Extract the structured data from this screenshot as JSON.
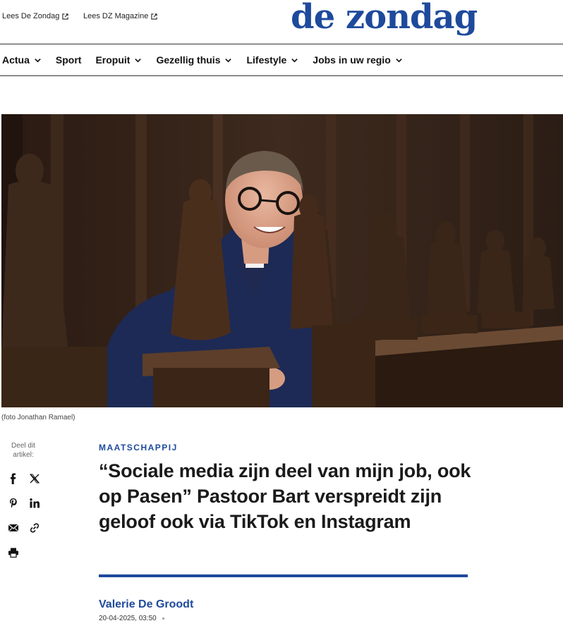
{
  "header": {
    "links": [
      {
        "label": "Lees De Zondag",
        "icon": "external-link-icon"
      },
      {
        "label": "Lees DZ Magazine",
        "icon": "external-link-icon"
      }
    ],
    "logo": "de zondag"
  },
  "nav": {
    "items": [
      {
        "label": "Actua",
        "has_dropdown": true
      },
      {
        "label": "Sport",
        "has_dropdown": false
      },
      {
        "label": "Eropuit",
        "has_dropdown": true
      },
      {
        "label": "Gezellig thuis",
        "has_dropdown": true
      },
      {
        "label": "Lifestyle",
        "has_dropdown": true
      },
      {
        "label": "Jobs in uw regio",
        "has_dropdown": true
      }
    ]
  },
  "article": {
    "image_caption": "(foto Jonathan Ramael)",
    "category": "MAATSCHAPPIJ",
    "headline": "“Sociale media zijn deel van mijn job, ook op Pasen” Pastoor Bart verspreidt zijn geloof ook via TikTok en Instagram",
    "author": "Valerie De Groodt",
    "date": "20-04-2025, 03:50"
  },
  "share": {
    "label": "Deel dit artikel:",
    "buttons": [
      "facebook-icon",
      "x-icon",
      "pinterest-icon",
      "linkedin-icon",
      "email-icon",
      "link-icon",
      "print-icon"
    ]
  },
  "colors": {
    "brand": "#1e4a9c",
    "text": "#1a1a1a"
  }
}
